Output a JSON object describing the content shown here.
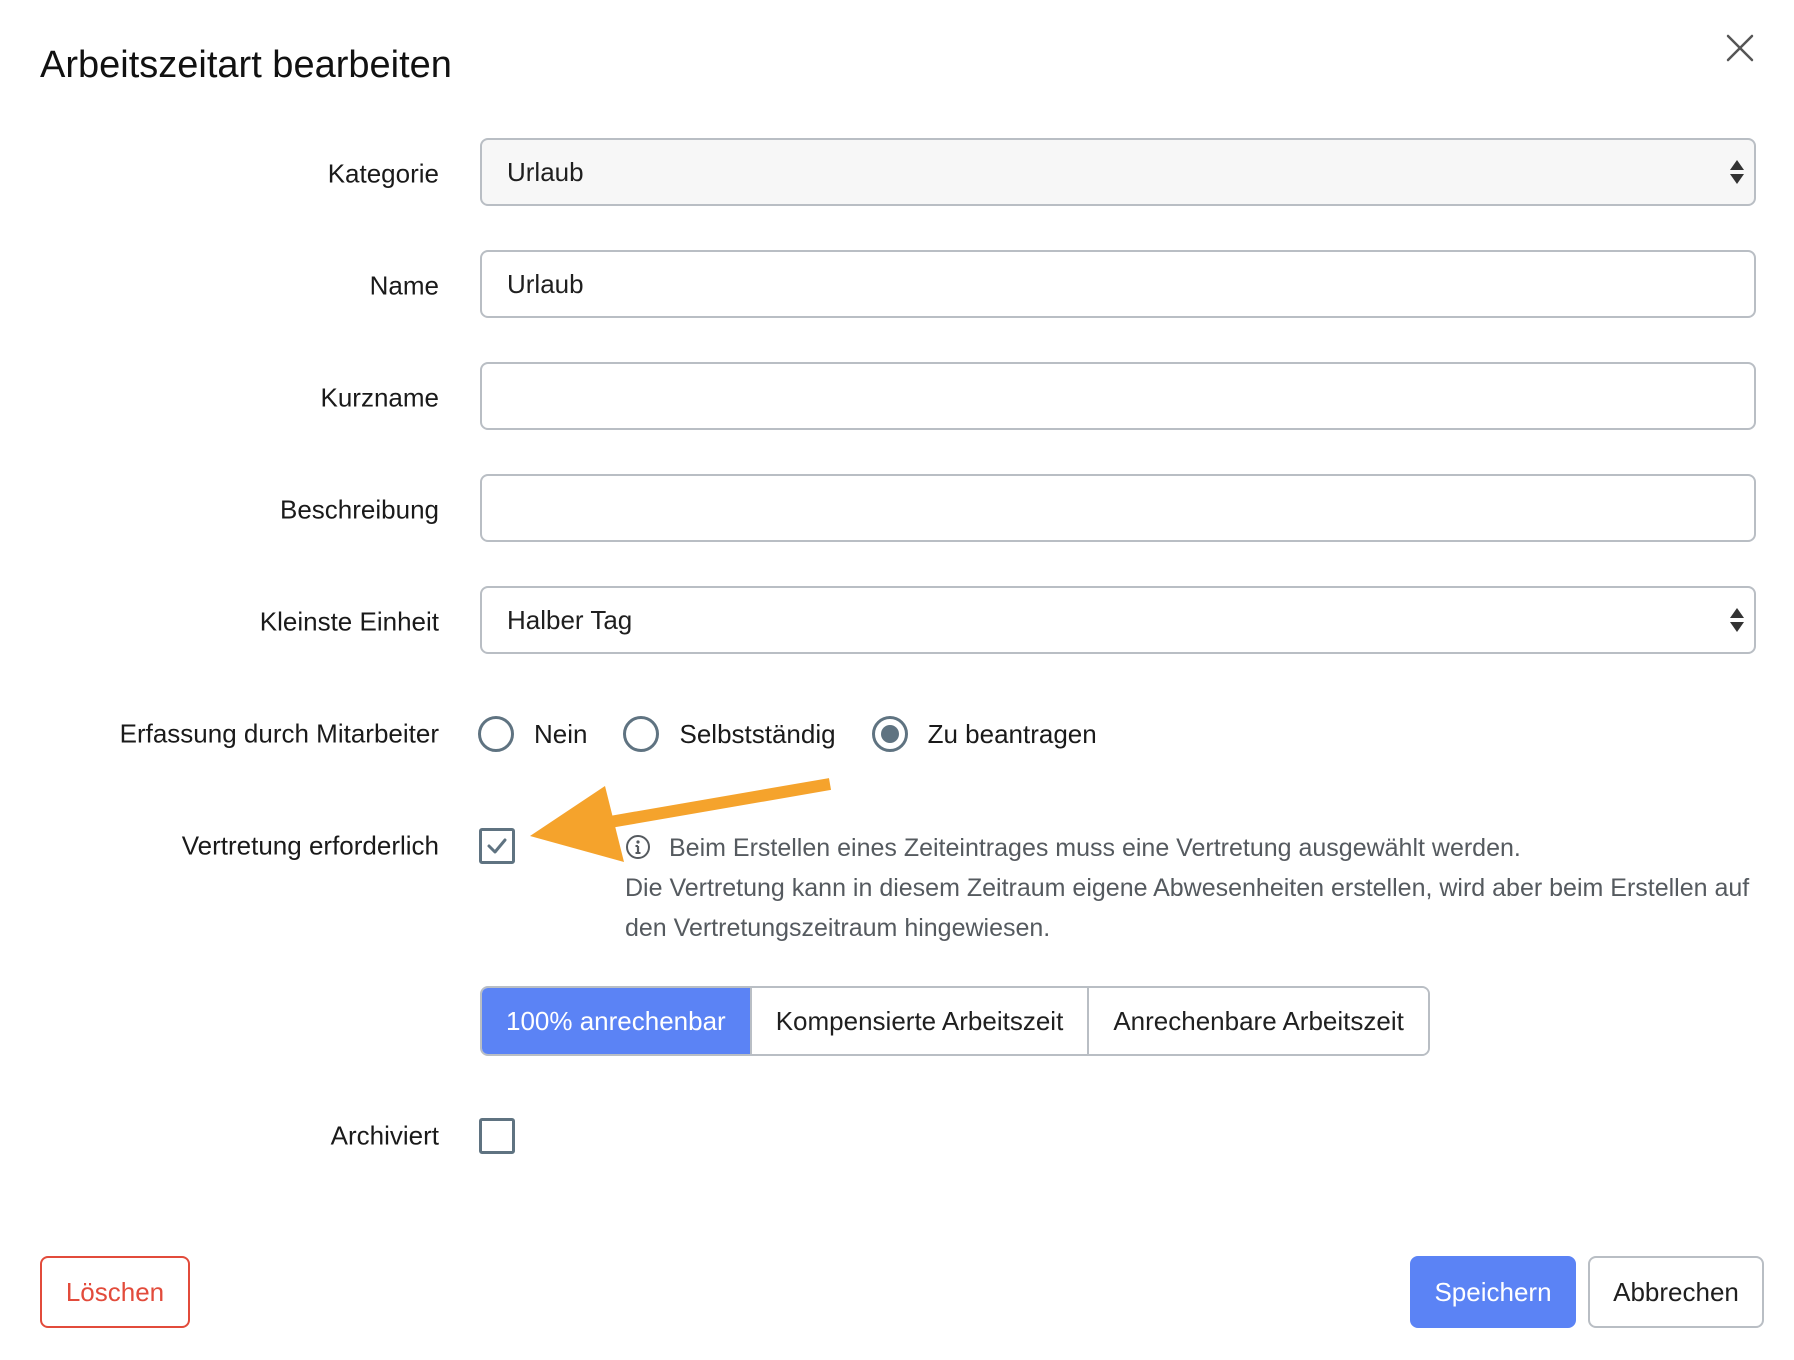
{
  "dialog": {
    "title": "Arbeitszeitart bearbeiten",
    "close_icon": "close-icon"
  },
  "form": {
    "kategorie": {
      "label": "Kategorie",
      "value": "Urlaub"
    },
    "name": {
      "label": "Name",
      "value": "Urlaub"
    },
    "kurzname": {
      "label": "Kurzname",
      "value": ""
    },
    "beschreibung": {
      "label": "Beschreibung",
      "value": ""
    },
    "kleinste_einheit": {
      "label": "Kleinste Einheit",
      "value": "Halber Tag"
    },
    "erfassung": {
      "label": "Erfassung durch Mitarbeiter",
      "options": [
        "Nein",
        "Selbstständig",
        "Zu beantragen"
      ],
      "selected": "Zu beantragen"
    },
    "vertretung": {
      "label": "Vertretung erforderlich",
      "checked": true,
      "info_line1": "Beim Erstellen eines Zeiteintrages muss eine Vertretung ausgewählt werden.",
      "info_line2": "Die Vertretung kann in diesem Zeitraum eigene Abwesenheiten erstellen, wird aber beim Erstellen auf den Vertretungszeitraum hingewiesen."
    },
    "anrechnung": {
      "options": [
        "100% anrechenbar",
        "Kompensierte Arbeitszeit",
        "Anrechenbare Arbeitszeit"
      ],
      "selected": "100% anrechenbar"
    },
    "archiviert": {
      "label": "Archiviert",
      "checked": false
    }
  },
  "footer": {
    "delete_label": "Löschen",
    "save_label": "Speichern",
    "cancel_label": "Abbrechen"
  },
  "colors": {
    "primary": "#5b83f5",
    "danger": "#e24b3b",
    "control": "#5f7381",
    "annotation_arrow": "#f5a32c"
  }
}
